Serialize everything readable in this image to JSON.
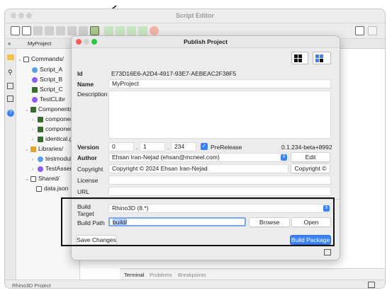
{
  "outer": {
    "title": "Script Editor",
    "root_tab": "MyProject",
    "status_text": "Rhino3D Project",
    "bottom_tabs": [
      "Terminal",
      "Problems",
      "Breakpoints"
    ],
    "tree": {
      "commands": "Commands/",
      "script_a": "Script_A",
      "script_b": "Script_B",
      "script_c": "Script_C",
      "testclib": "TestCLibr",
      "components": "Components",
      "comp1": "componer",
      "comp2": "componer",
      "identical": "identical.g",
      "libraries": "Libraries/",
      "testmodule": "testmodul",
      "testassem": "TestAssem",
      "shared": "Shared/",
      "datajson": "data.json"
    }
  },
  "dialog": {
    "title": "Publish Project",
    "id_label": "Id",
    "id_value": "E73D16E6-A2D4-4917-93E7-AEBEAC2F38F5",
    "name_label": "Name",
    "name_value": "MyProject",
    "description_label": "Description",
    "version_label": "Version",
    "version_major": "0",
    "version_minor": "1",
    "version_patch": "234",
    "version_sep": ".",
    "prerelease_label": "PreRelease",
    "prerelease_checked": true,
    "version_string": "0.1.234-beta+8992",
    "author_label": "Author",
    "author_value": "Ehsan Iran-Nejad (ehsan@mcneel.com)",
    "edit_button": "Edit",
    "copyright_label": "Copyright",
    "copyright_value": "Copyright © 2024 Ehsan Iran-Nejad",
    "copyright_button": "Copyright ©",
    "license_label": "License",
    "url_label": "URL",
    "build_target_label": "Build Target",
    "build_target_value": "Rhino3D (8.*)",
    "build_path_label": "Build Path",
    "build_path_value": "build/",
    "browse_button": "Browse",
    "open_button": "Open",
    "save_button": "Save Changes",
    "build_button": "Build Package"
  },
  "colors": {
    "accent": "#3b82f6",
    "close": "#ff5f57",
    "minimize": "#febc2e",
    "zoom": "#28c840"
  }
}
